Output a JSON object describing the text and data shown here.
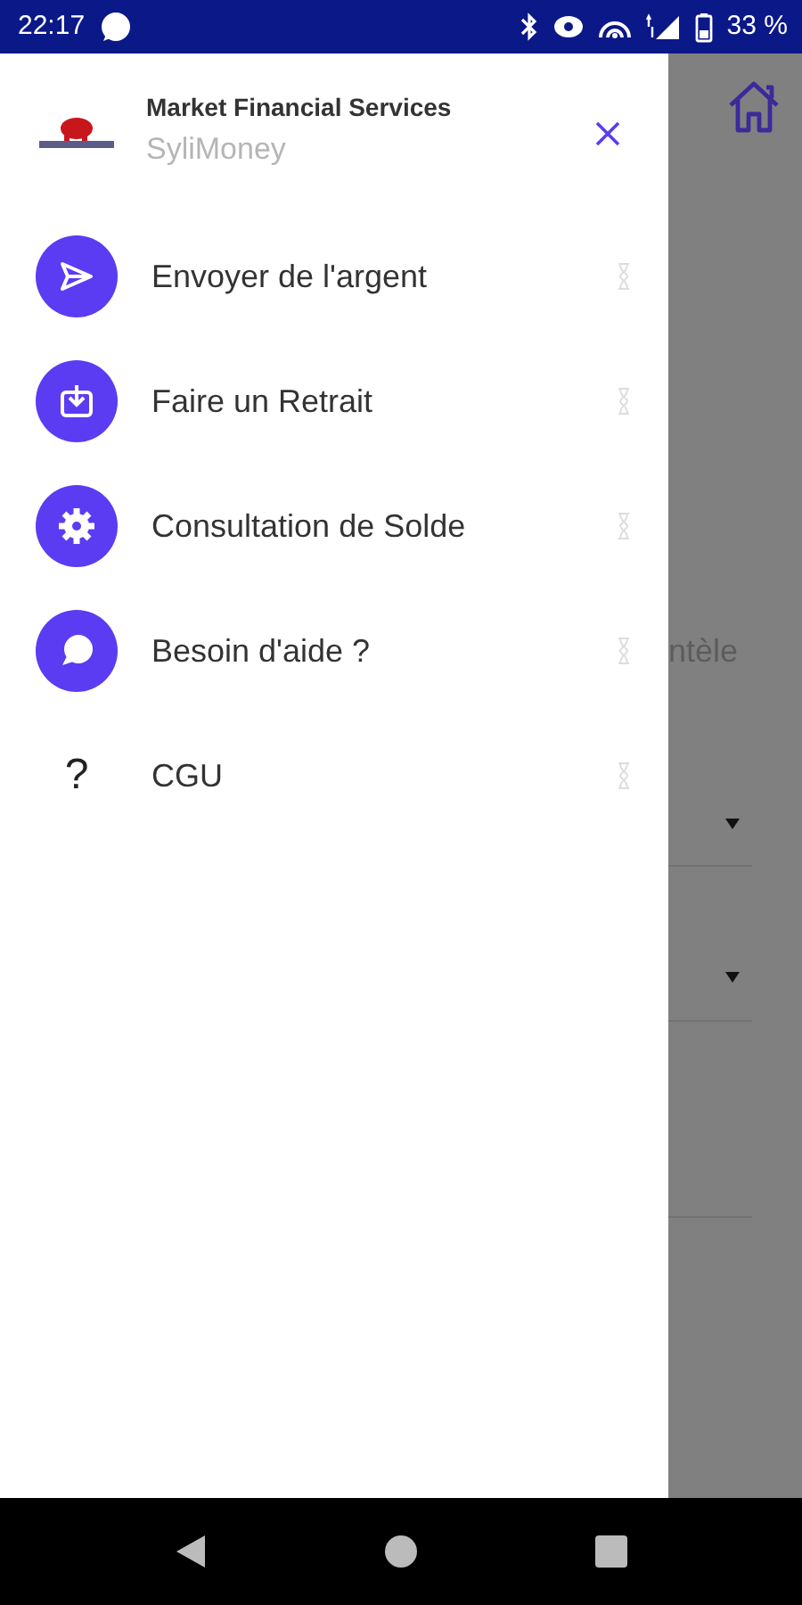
{
  "status_bar": {
    "time": "22:17",
    "battery": "33 %"
  },
  "drawer": {
    "organization": "Market Financial Services",
    "app_name": "SyliMoney",
    "items": [
      {
        "label": "Envoyer de l'argent",
        "kind": "circle"
      },
      {
        "label": "Faire un Retrait",
        "kind": "circle"
      },
      {
        "label": "Consultation de Solde",
        "kind": "circle"
      },
      {
        "label": "Besoin d'aide ?",
        "kind": "circle"
      },
      {
        "label": "CGU",
        "kind": "glyph",
        "glyph": "?"
      }
    ]
  },
  "background": {
    "partial_label": "ntèle"
  }
}
